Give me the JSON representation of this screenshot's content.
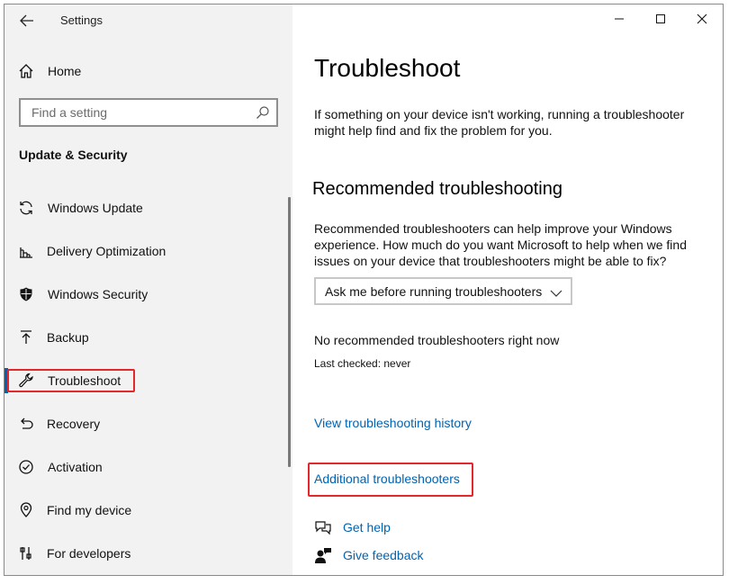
{
  "window": {
    "title": "Settings"
  },
  "sidebar": {
    "home_label": "Home",
    "search_placeholder": "Find a setting",
    "section_title": "Update & Security",
    "items": [
      {
        "label": "Windows Update",
        "icon": "sync-icon"
      },
      {
        "label": "Delivery Optimization",
        "icon": "delivery-optimization-icon"
      },
      {
        "label": "Windows Security",
        "icon": "shield-icon"
      },
      {
        "label": "Backup",
        "icon": "backup-arrow-icon"
      },
      {
        "label": "Troubleshoot",
        "icon": "wrench-icon",
        "selected": true
      },
      {
        "label": "Recovery",
        "icon": "recovery-icon"
      },
      {
        "label": "Activation",
        "icon": "activation-check-icon"
      },
      {
        "label": "Find my device",
        "icon": "find-device-icon"
      },
      {
        "label": "For developers",
        "icon": "developer-tools-icon"
      }
    ]
  },
  "main": {
    "title": "Troubleshoot",
    "intro": "If something on your device isn't working, running a troubleshooter might help find and fix the problem for you.",
    "recommended_heading": "Recommended troubleshooting",
    "recommended_text": "Recommended troubleshooters can help improve your Windows experience. How much do you want Microsoft to help when we find issues on your device that troubleshooters might be able to fix?",
    "dropdown_value": "Ask me before running troubleshooters",
    "no_recommended": "No recommended troubleshooters right now",
    "last_checked": "Last checked: never",
    "history_link": "View troubleshooting history",
    "additional_link": "Additional troubleshooters",
    "get_help": "Get help",
    "give_feedback": "Give feedback"
  },
  "colors": {
    "accent": "#0063b1",
    "highlight": "#e5262b",
    "sidebar_bg": "#f2f2f2"
  }
}
